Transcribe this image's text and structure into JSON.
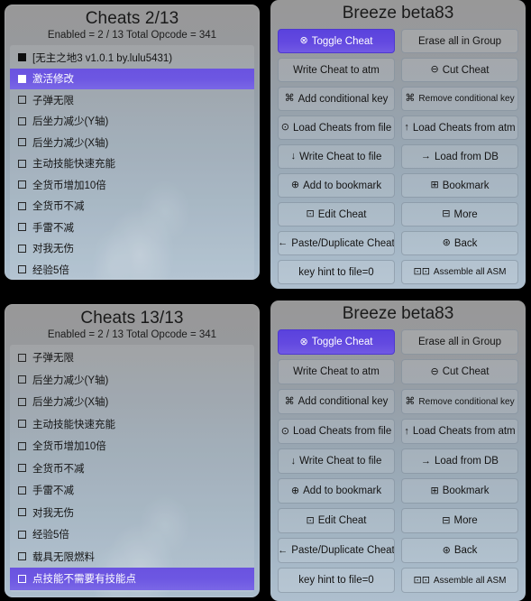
{
  "screens": [
    {
      "cheats": {
        "title": "Cheats 2/13",
        "subtitle": "Enabled = 2 / 13  Total Opcode = 341",
        "items": [
          {
            "label": "[无主之地3 v1.0.1 by.lulu5431)",
            "checkbox": "filled",
            "selected": false
          },
          {
            "label": "激活修改",
            "checkbox": "filled",
            "selected": true
          },
          {
            "label": "子弹无限",
            "checkbox": "empty",
            "selected": false
          },
          {
            "label": "后坐力减少(Y轴)",
            "checkbox": "empty",
            "selected": false
          },
          {
            "label": "后坐力减少(X轴)",
            "checkbox": "empty",
            "selected": false
          },
          {
            "label": "主动技能快速充能",
            "checkbox": "empty",
            "selected": false
          },
          {
            "label": "全货币增加10倍",
            "checkbox": "empty",
            "selected": false
          },
          {
            "label": "全货币不减",
            "checkbox": "empty",
            "selected": false
          },
          {
            "label": "手雷不减",
            "checkbox": "empty",
            "selected": false
          },
          {
            "label": "对我无伤",
            "checkbox": "empty",
            "selected": false
          },
          {
            "label": "经验5倍",
            "checkbox": "empty",
            "selected": false
          }
        ]
      },
      "breeze": {
        "title": "Breeze beta83",
        "buttons": [
          {
            "label": "Toggle Cheat",
            "icon": "⊗",
            "icon_name": "toggle-icon",
            "active": true
          },
          {
            "label": "Erase all in Group",
            "icon": "",
            "icon_name": "",
            "active": false
          },
          {
            "label": "Write Cheat to atm",
            "icon": "",
            "icon_name": "",
            "active": false
          },
          {
            "label": "Cut Cheat",
            "icon": "⊖",
            "icon_name": "cut-icon",
            "active": false
          },
          {
            "label": "Add conditional key",
            "icon": "⌘",
            "icon_name": "key-icon",
            "active": false
          },
          {
            "label": "Remove conditional key",
            "icon": "⌘",
            "icon_name": "key-icon",
            "active": false,
            "small": true
          },
          {
            "label": "Load Cheats from file",
            "icon": "⊙",
            "icon_name": "clock-icon",
            "active": false
          },
          {
            "label": "Load Cheats from atm",
            "icon": "↑",
            "icon_name": "arrow-up-icon",
            "active": false
          },
          {
            "label": "Write Cheat to file",
            "icon": "↓",
            "icon_name": "arrow-down-icon",
            "active": false
          },
          {
            "label": "Load from DB",
            "icon": "→",
            "icon_name": "arrow-right-icon",
            "active": false
          },
          {
            "label": "Add to bookmark",
            "icon": "⊕",
            "icon_name": "plus-circle-icon",
            "active": false
          },
          {
            "label": "Bookmark",
            "icon": "⊞",
            "icon_name": "bookmark-icon",
            "active": false
          },
          {
            "label": "Edit Cheat",
            "icon": "⊡",
            "icon_name": "edit-icon",
            "active": false
          },
          {
            "label": "More",
            "icon": "⊟",
            "icon_name": "more-icon",
            "active": false
          },
          {
            "label": "Paste/Duplicate Cheat",
            "icon": "←",
            "icon_name": "arrow-left-icon",
            "active": false
          },
          {
            "label": "Back",
            "icon": "⊛",
            "icon_name": "back-icon",
            "active": false
          },
          {
            "label": "key hint to file=0",
            "icon": "",
            "icon_name": "",
            "active": false
          },
          {
            "label": "Assemble all ASM",
            "icon": "⊡⊡",
            "icon_name": "assemble-icon",
            "active": false,
            "small": true
          }
        ]
      }
    },
    {
      "cheats": {
        "title": "Cheats 13/13",
        "subtitle": "Enabled = 2 / 13  Total Opcode = 341",
        "items": [
          {
            "label": "子弹无限",
            "checkbox": "empty",
            "selected": false
          },
          {
            "label": "后坐力减少(Y轴)",
            "checkbox": "empty",
            "selected": false
          },
          {
            "label": "后坐力减少(X轴)",
            "checkbox": "empty",
            "selected": false
          },
          {
            "label": "主动技能快速充能",
            "checkbox": "empty",
            "selected": false
          },
          {
            "label": "全货币增加10倍",
            "checkbox": "empty",
            "selected": false
          },
          {
            "label": "全货币不减",
            "checkbox": "empty",
            "selected": false
          },
          {
            "label": "手雷不减",
            "checkbox": "empty",
            "selected": false
          },
          {
            "label": "对我无伤",
            "checkbox": "empty",
            "selected": false
          },
          {
            "label": "经验5倍",
            "checkbox": "empty",
            "selected": false
          },
          {
            "label": "载具无限燃料",
            "checkbox": "empty",
            "selected": false
          },
          {
            "label": "点技能不需要有技能点",
            "checkbox": "empty",
            "selected": true
          }
        ]
      },
      "breeze": {
        "title": "Breeze beta83",
        "buttons": [
          {
            "label": "Toggle Cheat",
            "icon": "⊗",
            "icon_name": "toggle-icon",
            "active": true
          },
          {
            "label": "Erase all in Group",
            "icon": "",
            "icon_name": "",
            "active": false
          },
          {
            "label": "Write Cheat to atm",
            "icon": "",
            "icon_name": "",
            "active": false
          },
          {
            "label": "Cut Cheat",
            "icon": "⊖",
            "icon_name": "cut-icon",
            "active": false
          },
          {
            "label": "Add conditional key",
            "icon": "⌘",
            "icon_name": "key-icon",
            "active": false
          },
          {
            "label": "Remove conditional key",
            "icon": "⌘",
            "icon_name": "key-icon",
            "active": false,
            "small": true
          },
          {
            "label": "Load Cheats from file",
            "icon": "⊙",
            "icon_name": "clock-icon",
            "active": false
          },
          {
            "label": "Load Cheats from atm",
            "icon": "↑",
            "icon_name": "arrow-up-icon",
            "active": false
          },
          {
            "label": "Write Cheat to file",
            "icon": "↓",
            "icon_name": "arrow-down-icon",
            "active": false
          },
          {
            "label": "Load from DB",
            "icon": "→",
            "icon_name": "arrow-right-icon",
            "active": false
          },
          {
            "label": "Add to bookmark",
            "icon": "⊕",
            "icon_name": "plus-circle-icon",
            "active": false
          },
          {
            "label": "Bookmark",
            "icon": "⊞",
            "icon_name": "bookmark-icon",
            "active": false
          },
          {
            "label": "Edit Cheat",
            "icon": "⊡",
            "icon_name": "edit-icon",
            "active": false
          },
          {
            "label": "More",
            "icon": "⊟",
            "icon_name": "more-icon",
            "active": false
          },
          {
            "label": "Paste/Duplicate Cheat",
            "icon": "←",
            "icon_name": "arrow-left-icon",
            "active": false
          },
          {
            "label": "Back",
            "icon": "⊛",
            "icon_name": "back-icon",
            "active": false
          },
          {
            "label": "key hint to file=0",
            "icon": "",
            "icon_name": "",
            "active": false
          },
          {
            "label": "Assemble all ASM",
            "icon": "⊡⊡",
            "icon_name": "assemble-icon",
            "active": false,
            "small": true
          }
        ]
      }
    }
  ],
  "colors": {
    "accent": "#6a53e0",
    "panel_top": "#989898",
    "panel_bottom": "#aebfce",
    "text": "#141414"
  }
}
